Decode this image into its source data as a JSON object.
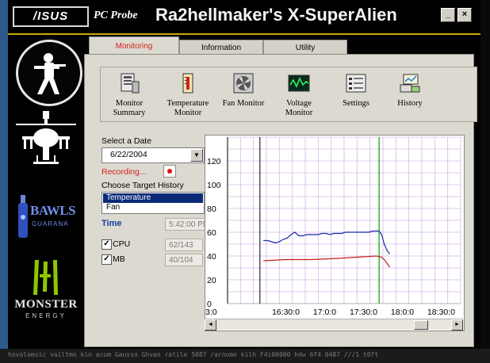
{
  "window": {
    "brand": "/ISUS",
    "app_name": "PC Probe",
    "title": "Ra2hellmaker's X-SuperAlien",
    "minimize_label": "_",
    "close_label": "×"
  },
  "tabs": [
    {
      "label": "Monitoring",
      "active": true
    },
    {
      "label": "Information",
      "active": false
    },
    {
      "label": "Utility",
      "active": false
    }
  ],
  "toolbar": [
    {
      "label": "Monitor Summary",
      "icon": "monitor-summary-icon"
    },
    {
      "label": "Temperature Monitor",
      "icon": "thermometer-icon"
    },
    {
      "label": "Fan Monitor",
      "icon": "fan-icon"
    },
    {
      "label": "Voltage Monitor",
      "icon": "voltage-icon"
    },
    {
      "label": "Settings",
      "icon": "settings-icon"
    },
    {
      "label": "History",
      "icon": "history-icon"
    }
  ],
  "history": {
    "select_date_label": "Select a Date",
    "date_value": "6/22/2004",
    "recording_label": "Recording...",
    "target_label": "Choose Target History",
    "targets": [
      "Temperature",
      "Fan"
    ],
    "selected_target": "Temperature",
    "time_label": "Time",
    "time_value": "5:42:00 PM",
    "cpu_label": "CPU",
    "cpu_checked": true,
    "cpu_value": "62/143",
    "mb_label": "MB",
    "mb_checked": true,
    "mb_value": "40/104"
  },
  "logos": {
    "bawls_line1": "BAWLS",
    "bawls_line2": "GUARANA",
    "monster_line1": "MONSTER",
    "monster_line2": "ENERGY"
  },
  "desktop_strip": "hovolomsic   vailtmn kin   acum   Gausso  Ghvan ratile   5087 /arnomo   kilh  F4i00000   hdw 6f4 0487 ///1 t0ft",
  "colors": {
    "cpu_series": "#1a2aa8",
    "mb_series": "#c81e1e",
    "marker": "#00a000",
    "grid": "#d6b8e6",
    "tab_active_text": "#d62020"
  },
  "chart_data": {
    "type": "line",
    "title": "",
    "xlabel": "",
    "ylabel": "",
    "ylim": [
      0,
      140
    ],
    "xlim_minutes": [
      945,
      1125
    ],
    "x_tick_labels": [
      "3:0",
      "16:30:0",
      "17:0:0",
      "17:30:0",
      "18:0:0",
      "18:30:0"
    ],
    "y_tick_labels": [
      "0",
      "20",
      "40",
      "60",
      "80",
      "100",
      "120"
    ],
    "y_ticks": [
      0,
      20,
      40,
      60,
      80,
      100,
      120
    ],
    "marker_time": "17:42:00",
    "series": [
      {
        "name": "CPU",
        "color": "#1a2aa8",
        "points": [
          [
            "16:13",
            53
          ],
          [
            "16:16",
            53
          ],
          [
            "16:19",
            52
          ],
          [
            "16:22",
            51
          ],
          [
            "16:25",
            52
          ],
          [
            "16:28",
            54
          ],
          [
            "16:31",
            55
          ],
          [
            "16:34",
            58
          ],
          [
            "16:37",
            60
          ],
          [
            "16:40",
            57
          ],
          [
            "16:43",
            57
          ],
          [
            "16:46",
            58
          ],
          [
            "16:49",
            58
          ],
          [
            "16:52",
            58
          ],
          [
            "16:55",
            58
          ],
          [
            "16:58",
            59
          ],
          [
            "17:01",
            59
          ],
          [
            "17:04",
            58
          ],
          [
            "17:07",
            59
          ],
          [
            "17:10",
            59
          ],
          [
            "17:13",
            59
          ],
          [
            "17:16",
            60
          ],
          [
            "17:19",
            60
          ],
          [
            "17:22",
            60
          ],
          [
            "17:25",
            60
          ],
          [
            "17:28",
            60
          ],
          [
            "17:31",
            60
          ],
          [
            "17:34",
            60
          ],
          [
            "17:37",
            61
          ],
          [
            "17:40",
            61
          ],
          [
            "17:42",
            61
          ],
          [
            "17:44",
            58
          ],
          [
            "17:46",
            50
          ],
          [
            "17:48",
            45
          ],
          [
            "17:50",
            42
          ]
        ]
      },
      {
        "name": "MB",
        "color": "#c81e1e",
        "points": [
          [
            "16:13",
            36
          ],
          [
            "16:30",
            37
          ],
          [
            "16:50",
            37
          ],
          [
            "17:10",
            38
          ],
          [
            "17:25",
            39
          ],
          [
            "17:40",
            40
          ],
          [
            "17:44",
            39
          ],
          [
            "17:46",
            37
          ],
          [
            "17:48",
            34
          ],
          [
            "17:50",
            31
          ]
        ]
      }
    ]
  }
}
